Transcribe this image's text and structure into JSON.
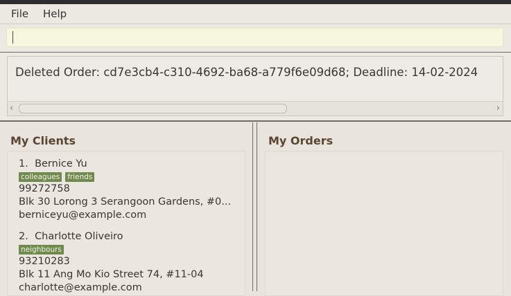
{
  "menu": {
    "file": "File",
    "help": "Help"
  },
  "command": {
    "value": "",
    "placeholder": ""
  },
  "result": {
    "text": "Deleted Order: cd7e3cb4-c310-4692-ba68-a779f6e09d68; Deadline: 14-02-2024"
  },
  "clients_panel": {
    "title": "My Clients",
    "clients": [
      {
        "index": "1.",
        "name": "Bernice Yu",
        "tags": [
          "colleagues",
          "friends"
        ],
        "phone": "99272758",
        "address": "Blk 30 Lorong 3 Serangoon Gardens, #0...",
        "email": "berniceyu@example.com"
      },
      {
        "index": "2.",
        "name": "Charlotte Oliveiro",
        "tags": [
          "neighbours"
        ],
        "phone": "93210283",
        "address": "Blk 11 Ang Mo Kio Street 74, #11-04",
        "email": "charlotte@example.com"
      }
    ]
  },
  "orders_panel": {
    "title": "My Orders"
  },
  "icons": {
    "scroll_left": "chevron-left-icon",
    "scroll_right": "chevron-right-icon"
  },
  "colors": {
    "tag": "#6f8a4c",
    "command_bg": "#f7f6df",
    "title": "#5a4632"
  }
}
